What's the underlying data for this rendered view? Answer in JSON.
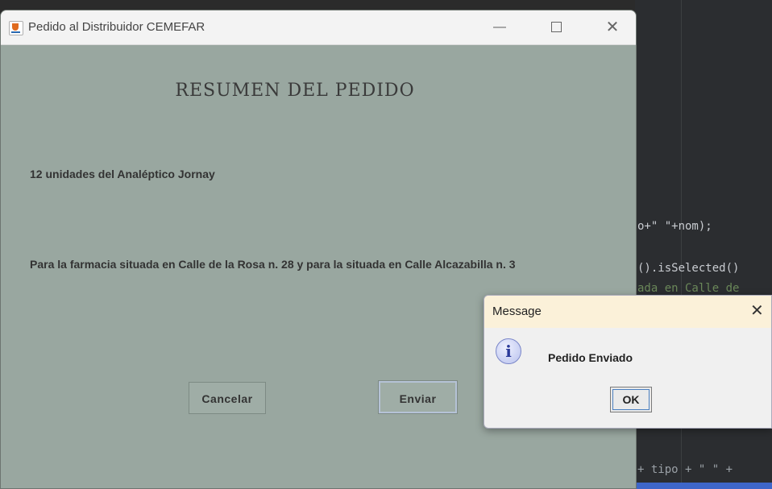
{
  "window": {
    "title": "Pedido al Distribuidor CEMEFAR",
    "controls": {
      "minimize": "—",
      "close": "✕"
    }
  },
  "summary": {
    "heading": "RESUMEN DEL PEDIDO",
    "line1": "12 unidades del Analéptico Jornay",
    "line2": "Para la farmacia situada en Calle de la Rosa n. 28  y para la situada en Calle Alcazabilla n. 3"
  },
  "buttons": {
    "cancel": "Cancelar",
    "send": "Enviar"
  },
  "dialog": {
    "title": "Message",
    "close": "✕",
    "icon": "info-icon",
    "icon_glyph": "i",
    "message": "Pedido Enviado",
    "ok": "OK"
  },
  "ide": {
    "code1": "o+\" \"+nom);",
    "code2": "().isSelected()",
    "code3": "ada en Calle de",
    "code4": "+ tipo + \" \" +"
  }
}
